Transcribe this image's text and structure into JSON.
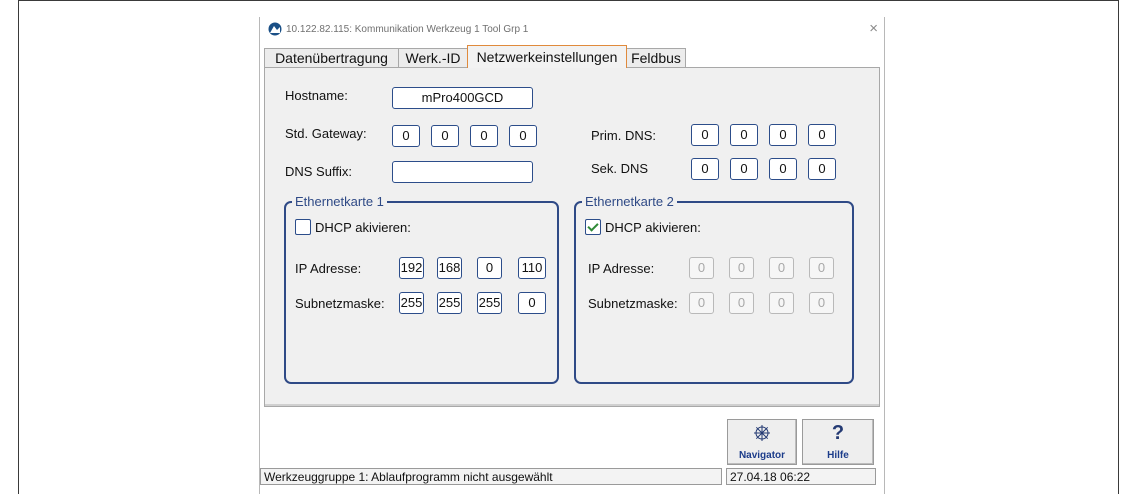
{
  "window": {
    "title": "10.122.82.115: Kommunikation  Werkzeug 1  Tool Grp 1",
    "close_glyph": "×"
  },
  "tabs": [
    {
      "label": "Datenübertragung",
      "active": false
    },
    {
      "label": "Werk.-ID",
      "active": false
    },
    {
      "label": "Netzwerkeinstellungen",
      "active": true
    },
    {
      "label": "Feldbus",
      "active": false
    }
  ],
  "form": {
    "hostname_label": "Hostname:",
    "hostname_value": "mPro400GCD",
    "gateway_label": "Std. Gateway:",
    "gateway": [
      "0",
      "0",
      "0",
      "0"
    ],
    "dns_suffix_label": "DNS Suffix:",
    "dns_suffix_value": "",
    "prim_dns_label": "Prim. DNS:",
    "prim_dns": [
      "0",
      "0",
      "0",
      "0"
    ],
    "sek_dns_label": "Sek. DNS",
    "sek_dns": [
      "0",
      "0",
      "0",
      "0"
    ]
  },
  "eth1": {
    "legend": "Ethernetkarte 1",
    "dhcp_label": "DHCP akivieren:",
    "dhcp_checked": false,
    "ip_label": "IP Adresse:",
    "ip": [
      "192",
      "168",
      "0",
      "110"
    ],
    "mask_label": "Subnetzmaske:",
    "mask": [
      "255",
      "255",
      "255",
      "0"
    ]
  },
  "eth2": {
    "legend": "Ethernetkarte 2",
    "dhcp_label": "DHCP akivieren:",
    "dhcp_checked": true,
    "ip_label": "IP Adresse:",
    "ip": [
      "0",
      "0",
      "0",
      "0"
    ],
    "mask_label": "Subnetzmaske:",
    "mask": [
      "0",
      "0",
      "0",
      "0"
    ]
  },
  "buttons": {
    "navigator_label": "Navigator",
    "navigator_icon": "compass-icon",
    "help_label": "Hilfe",
    "help_icon": "question-icon"
  },
  "status": {
    "message": "Werkzeuggruppe 1: Ablaufprogramm nicht ausgewählt",
    "datetime": "27.04.18 06:22"
  }
}
